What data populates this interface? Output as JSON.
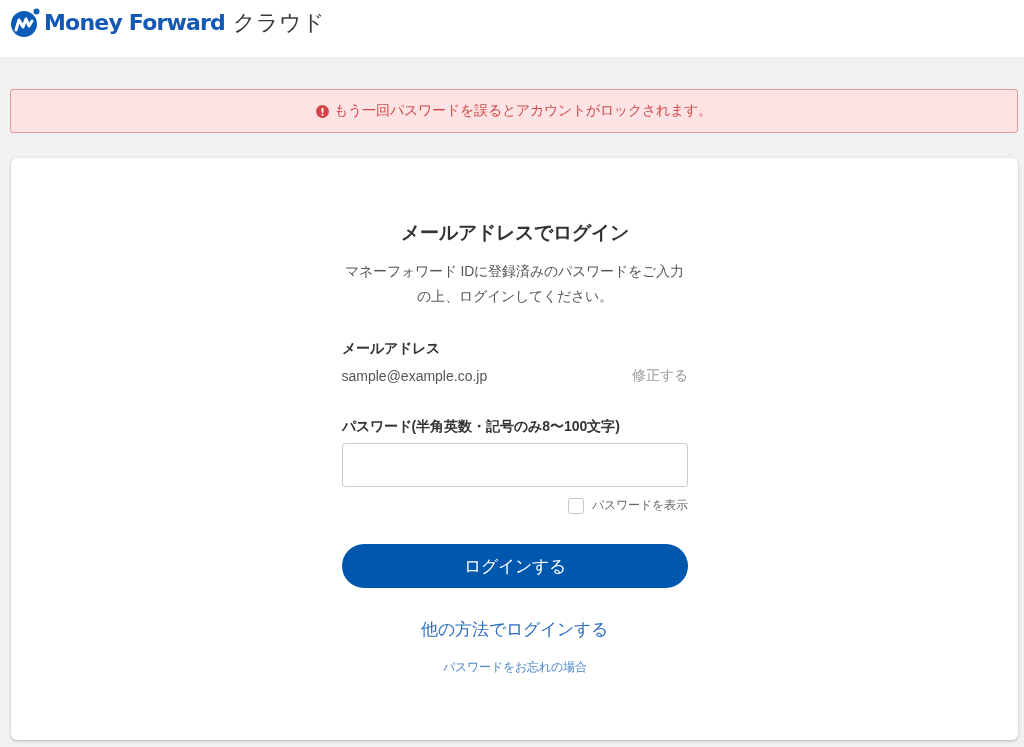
{
  "header": {
    "logo": {
      "brand": "Money Forward",
      "product": "クラウド"
    }
  },
  "alert": {
    "kind": "error",
    "message": "もう一回パスワードを誤るとアカウントがロックされます。"
  },
  "login": {
    "title": "メールアドレスでログイン",
    "description": "マネーフォワード IDに登録済みのパスワードをご入力の上、ログインしてください。",
    "email": {
      "label": "メールアドレス",
      "value": "sample@example.co.jp",
      "edit_link": "修正する"
    },
    "password": {
      "label": "パスワード(半角英数・記号のみ8〜100文字)",
      "show_password": {
        "label": "パスワードを表示",
        "checked": false
      }
    },
    "submit_button": "ログインする",
    "other_method_link": "他の方法でログインする",
    "forgot_link": "パスワードをお忘れの場合"
  }
}
